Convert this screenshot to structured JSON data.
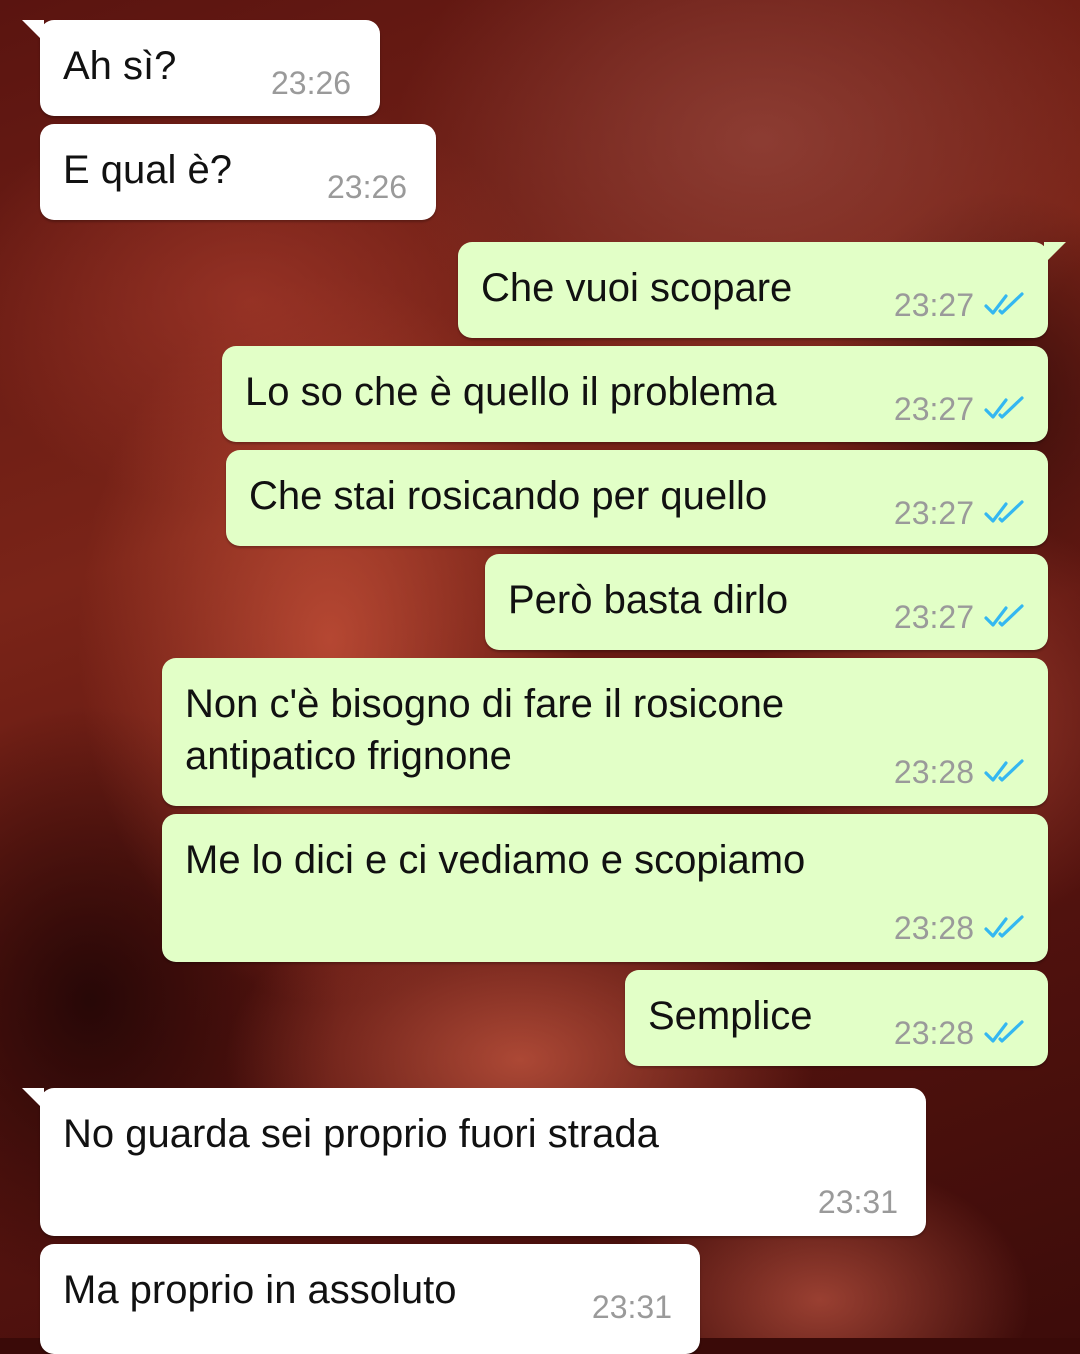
{
  "chat": {
    "messages": [
      {
        "direction": "in",
        "text": "Ah sì?",
        "time": "23:26"
      },
      {
        "direction": "in",
        "text": "E qual è?",
        "time": "23:26"
      },
      {
        "direction": "out",
        "text": "Che vuoi scopare",
        "time": "23:27",
        "status": "read"
      },
      {
        "direction": "out",
        "text": "Lo so che è quello il problema",
        "time": "23:27",
        "status": "read"
      },
      {
        "direction": "out",
        "text": "Che stai rosicando per quello",
        "time": "23:27",
        "status": "read"
      },
      {
        "direction": "out",
        "text": "Però basta dirlo",
        "time": "23:27",
        "status": "read"
      },
      {
        "direction": "out",
        "text": "Non c'è bisogno di fare il rosicone\nantipatico frignone",
        "time": "23:28",
        "status": "read"
      },
      {
        "direction": "out",
        "text": "Me lo dici e ci vediamo e scopiamo",
        "time": "23:28",
        "status": "read"
      },
      {
        "direction": "out",
        "text": "Semplice",
        "time": "23:28",
        "status": "read"
      },
      {
        "direction": "in",
        "text": "No guarda sei proprio fuori strada",
        "time": "23:31"
      },
      {
        "direction": "in",
        "text": "Ma proprio in assoluto",
        "time": "23:31"
      }
    ]
  },
  "colors": {
    "incoming_bubble": "#ffffff",
    "outgoing_bubble": "#e2ffc7",
    "timestamp": "#9a9a9a",
    "read_ticks": "#34b7f1"
  },
  "icons": {
    "read_receipt": "double-check-icon"
  }
}
